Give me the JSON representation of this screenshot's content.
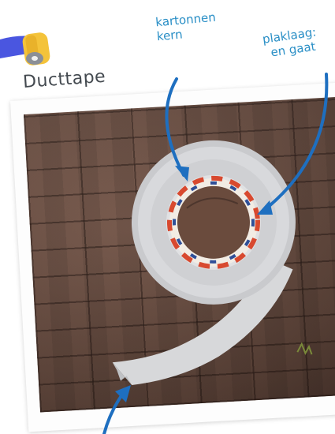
{
  "title": "Ducttape",
  "annotations": {
    "core": [
      "kartonnen",
      "kern"
    ],
    "adhesive": [
      "plaklaag:",
      "en gaat"
    ]
  },
  "colors": {
    "annotation": "#2a8fc6",
    "title": "#444a50",
    "tape_icon_blue": "#4a56e0",
    "tape_icon_yellow": "#f4c33a"
  },
  "icons": [
    "tape-dispenser-icon",
    "arrow-icon"
  ]
}
